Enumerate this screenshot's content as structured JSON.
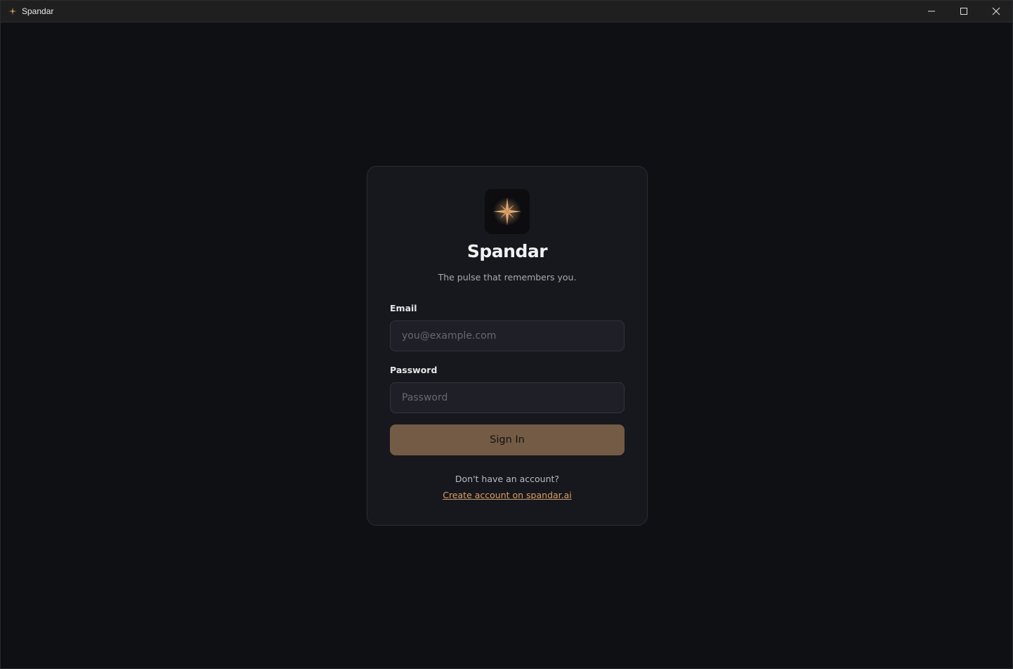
{
  "window": {
    "title": "Spandar",
    "icon": "spark-star-icon",
    "controls": {
      "minimize": "minimize-icon",
      "maximize": "maximize-icon",
      "close": "close-icon"
    }
  },
  "login": {
    "logo_icon": "spark-star-icon",
    "app_name": "Spandar",
    "tagline": "The pulse that remembers you.",
    "email_label": "Email",
    "email_value": "",
    "email_placeholder": "you@example.com",
    "password_label": "Password",
    "password_value": "",
    "password_placeholder": "Password",
    "signin_label": "Sign In",
    "no_account_text": "Don't have an account?",
    "create_account_link": "Create account on spandar.ai"
  },
  "colors": {
    "background": "#0f1013",
    "card": "#17181d",
    "accent": "#d89f6a",
    "button": "#735b45"
  }
}
